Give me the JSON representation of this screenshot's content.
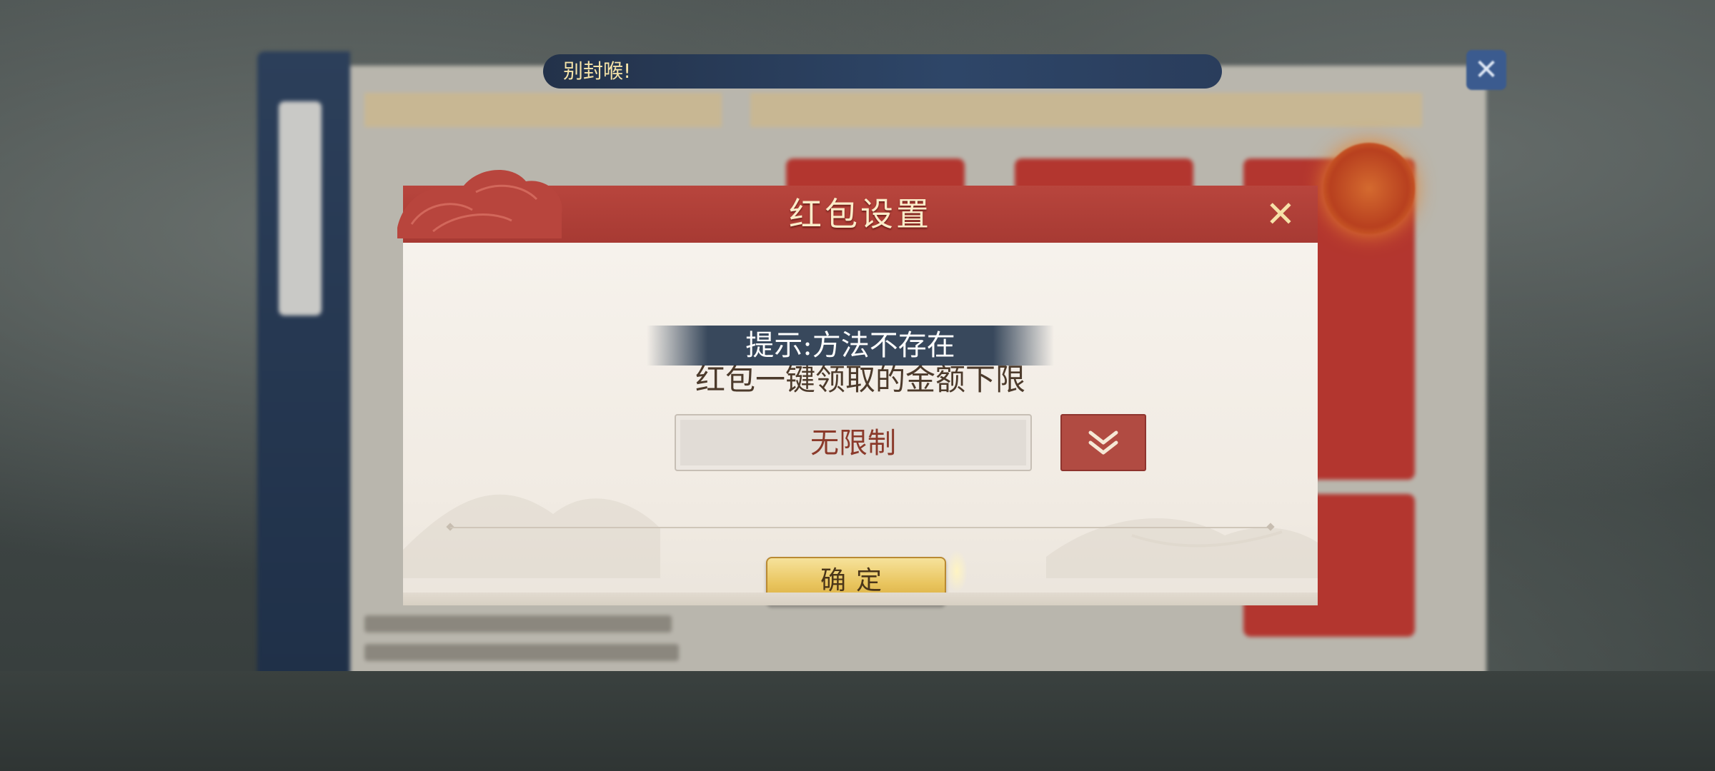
{
  "background": {
    "banner_text": "别封喉!",
    "close_icon": "close-icon"
  },
  "dialog": {
    "title": "红包设置",
    "close_label": "✕",
    "setting_label": "红包一键领取的金额下限",
    "selected_value": "无限制",
    "dropdown_icon": "double-chevron-down-icon",
    "confirm_label": "确定"
  },
  "toast": {
    "message": "提示:方法不存在"
  },
  "colors": {
    "header_red": "#b8453d",
    "title_gold": "#fbecc9",
    "button_gold": "#e9c55f",
    "dropdown_red": "#b14b42"
  }
}
